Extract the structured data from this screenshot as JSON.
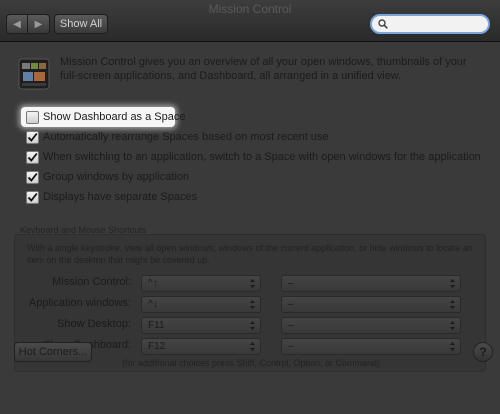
{
  "window": {
    "title": "Mission Control"
  },
  "toolbar": {
    "back_icon": "chevron-left-icon",
    "forward_icon": "chevron-right-icon",
    "show_all_label": "Show All",
    "search_placeholder": "",
    "search_icon": "magnifier-icon"
  },
  "intro": {
    "app_icon": "mission-control-icon",
    "text": "Mission Control gives you an overview of all your open windows, thumbnails of your full-screen applications, and Dashboard, all arranged in a unified view."
  },
  "options": [
    {
      "label": "Show Dashboard as a Space",
      "checked": false
    },
    {
      "label": "Automatically rearrange Spaces based on most recent use",
      "checked": true
    },
    {
      "label": "When switching to an application, switch to a Space with open windows for the application",
      "checked": true
    },
    {
      "label": "Group windows by application",
      "checked": true
    },
    {
      "label": "Displays have separate Spaces",
      "checked": true
    }
  ],
  "shortcuts": {
    "title": "Keyboard and Mouse Shortcuts",
    "description": "With a single keystroke, view all open windows, windows of the current application, or hide windows to locate an item on the desktop that might be covered up.",
    "rows": [
      {
        "label": "Mission Control:",
        "key": "^↑",
        "mouse": "–"
      },
      {
        "label": "Application windows:",
        "key": "^↓",
        "mouse": "–"
      },
      {
        "label": "Show Desktop:",
        "key": "F11",
        "mouse": "–"
      },
      {
        "label": "Show Dashboard:",
        "key": "F12",
        "mouse": "–"
      }
    ],
    "footnote": "(for additional choices press Shift, Control, Option, or Command)"
  },
  "footer": {
    "hot_corners_label": "Hot Corners...",
    "help_label": "?"
  },
  "colors": {
    "highlight": "#f6f6f6",
    "search_focus": "#7aa5d8"
  }
}
